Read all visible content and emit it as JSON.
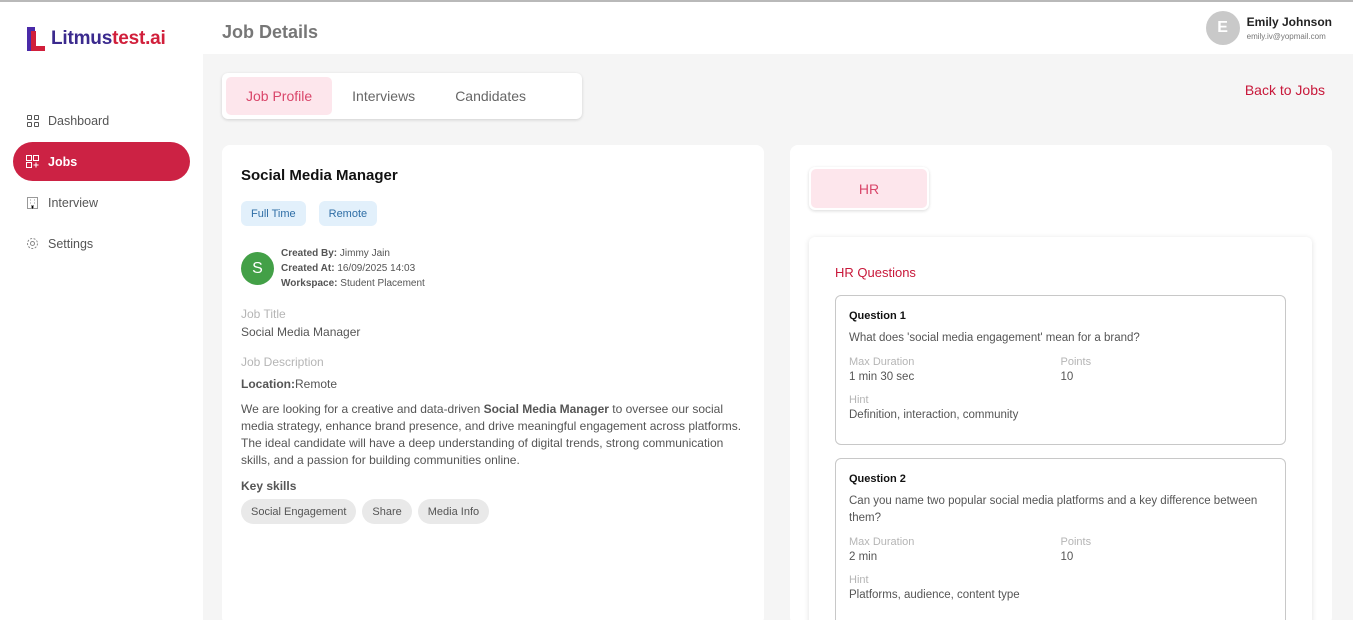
{
  "brand": {
    "logo_part1": "Litmus",
    "logo_part2": "test.ai"
  },
  "sidebar": {
    "items": [
      {
        "label": "Dashboard",
        "icon": "dashboard-icon",
        "active": false
      },
      {
        "label": "Jobs",
        "icon": "jobs-icon",
        "active": true
      },
      {
        "label": "Interview",
        "icon": "building-icon",
        "active": false
      },
      {
        "label": "Settings",
        "icon": "gear-icon",
        "active": false
      }
    ]
  },
  "header": {
    "title": "Job Details",
    "user": {
      "initial": "E",
      "name": "Emily Johnson",
      "email": "emily.iv@yopmail.com"
    }
  },
  "tabs": [
    "Job Profile",
    "Interviews",
    "Candidates"
  ],
  "back_link": "Back to Jobs",
  "job": {
    "name": "Social Media Manager",
    "tags": [
      "Full Time",
      "Remote"
    ],
    "creator_initial": "S",
    "created_by_label": "Created By:",
    "created_by": "Jimmy Jain",
    "created_at_label": "Created At:",
    "created_at": "16/09/2025 14:03",
    "workspace_label": "Workspace:",
    "workspace": "Student Placement",
    "title_label": "Job Title",
    "title_value": "Social Media Manager",
    "description_label": "Job Description",
    "location_label": "Location:",
    "location_value": "Remote",
    "desc_part1": "We are looking for a creative and data-driven ",
    "desc_bold": "Social Media Manager",
    "desc_part2": " to oversee our social media strategy, enhance brand presence, and drive meaningful engagement across platforms. The ideal candidate will have a deep understanding of digital trends, strong communication skills, and a passion for building communities online.",
    "skills_label": "Key skills",
    "skills": [
      "Social Engagement",
      "Share",
      "Media Info"
    ]
  },
  "hr": {
    "tab_label": "HR",
    "section_title": "HR Questions",
    "questions": [
      {
        "title": "Question 1",
        "text": "What does 'social media engagement' mean for a brand?",
        "duration_label": "Max Duration",
        "duration": "1 min 30 sec",
        "points_label": "Points",
        "points": "10",
        "hint_label": "Hint",
        "hint": "Definition, interaction, community"
      },
      {
        "title": "Question 2",
        "text": "Can you name two popular social media platforms and a key difference between them?",
        "duration_label": "Max Duration",
        "duration": "2 min",
        "points_label": "Points",
        "points": "10",
        "hint_label": "Hint",
        "hint": "Platforms, audience, content type"
      }
    ]
  }
}
